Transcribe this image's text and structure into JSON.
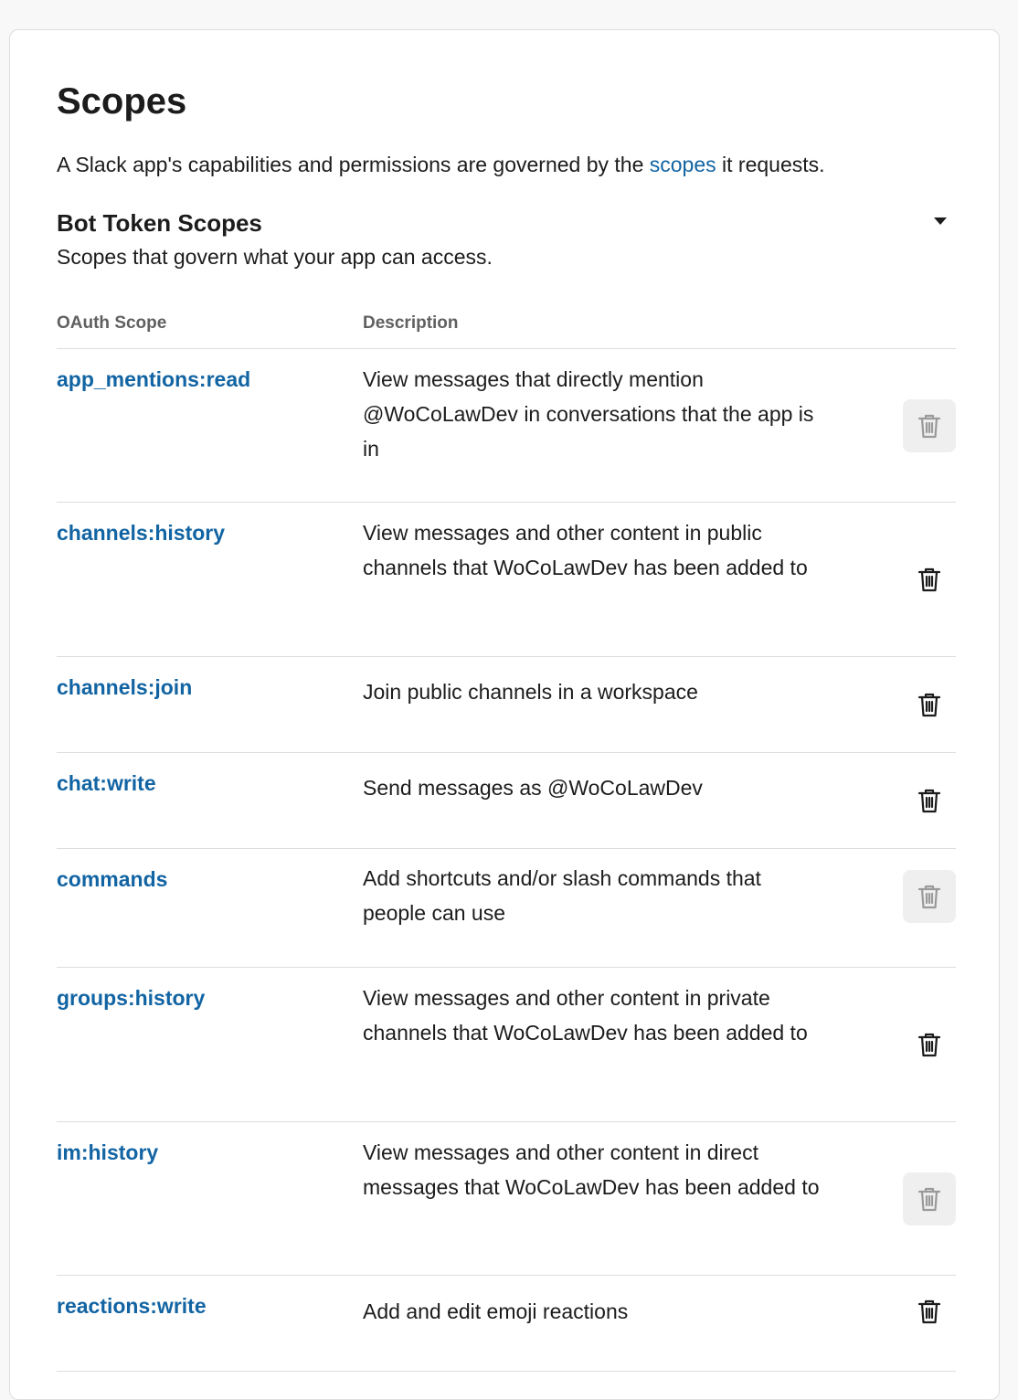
{
  "page": {
    "title": "Scopes",
    "intro_before": "A Slack app's capabilities and permissions are governed by the ",
    "intro_link": "scopes",
    "intro_after": " it requests."
  },
  "bot_scopes": {
    "title": "Bot Token Scopes",
    "subtitle": "Scopes that govern what your app can access.",
    "toggle_icon": "caret-down-icon",
    "columns": {
      "scope": "OAuth Scope",
      "description": "Description"
    },
    "rows": [
      {
        "scope": "app_mentions:read",
        "description": "View messages that directly mention @WoCoLawDev in conversations that the app is in",
        "delete_hover": true
      },
      {
        "scope": "channels:history",
        "description": "View messages and other content in public channels that WoCoLawDev has been added to",
        "delete_hover": false
      },
      {
        "scope": "channels:join",
        "description": "Join public channels in a workspace",
        "delete_hover": false
      },
      {
        "scope": "chat:write",
        "description": "Send messages as @WoCoLawDev",
        "delete_hover": false
      },
      {
        "scope": "commands",
        "description": "Add shortcuts and/or slash commands that people can use",
        "delete_hover": true
      },
      {
        "scope": "groups:history",
        "description": "View messages and other content in private channels that WoCoLawDev has been added to",
        "delete_hover": false
      },
      {
        "scope": "im:history",
        "description": "View messages and other content in direct messages that WoCoLawDev has been added to",
        "delete_hover": true
      },
      {
        "scope": "reactions:write",
        "description": "Add and edit emoji reactions",
        "delete_hover": false
      }
    ]
  },
  "colors": {
    "link": "#1264a3",
    "text": "#1d1c1d",
    "muted": "#616061",
    "disabled_icon": "#9a9a9a"
  }
}
